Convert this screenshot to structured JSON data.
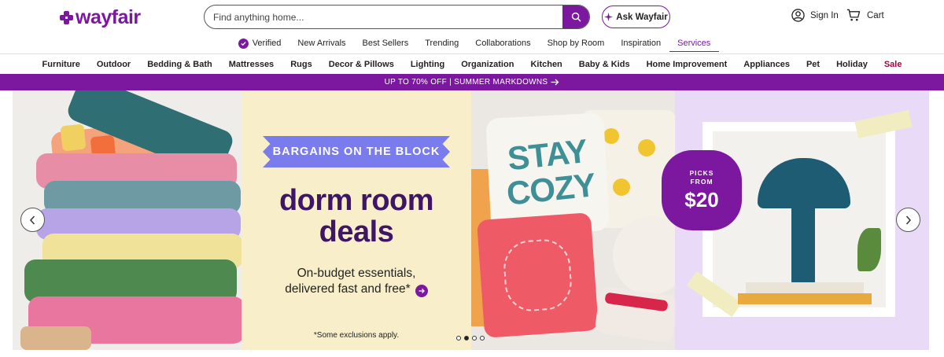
{
  "brand": {
    "name": "wayfair",
    "color": "#7b189f"
  },
  "header": {
    "search_placeholder": "Find anything home...",
    "ask_label": "Ask Wayfair",
    "sign_in_label": "Sign In",
    "cart_label": "Cart"
  },
  "subnav": [
    {
      "label": "Verified",
      "icon": "verified-badge-icon"
    },
    {
      "label": "New Arrivals"
    },
    {
      "label": "Best Sellers"
    },
    {
      "label": "Trending"
    },
    {
      "label": "Collaborations"
    },
    {
      "label": "Shop by Room"
    },
    {
      "label": "Inspiration"
    },
    {
      "label": "Services",
      "active": true
    }
  ],
  "categories": [
    "Furniture",
    "Outdoor",
    "Bedding & Bath",
    "Mattresses",
    "Rugs",
    "Decor & Pillows",
    "Lighting",
    "Organization",
    "Kitchen",
    "Baby & Kids",
    "Home Improvement",
    "Appliances",
    "Pet",
    "Holiday",
    "Sale"
  ],
  "promo_bar": {
    "text": "UP TO 70% OFF | SUMMER MARKDOWNS",
    "icon": "arrow-right-icon"
  },
  "hero": {
    "tag": "BARGAINS ON THE BLOCK",
    "headline_line1": "dorm room",
    "headline_line2": "deals",
    "subline_line1": "On-budget essentials,",
    "subline_line2": "delivered fast and free*",
    "fine_print": "*Some exclusions apply.",
    "picks_line1": "PICKS",
    "picks_line2": "FROM",
    "picks_price": "$20",
    "pillow_text_1": "STAY",
    "pillow_text_2": "COZY",
    "carousel": {
      "slides": 4,
      "active_index": 1
    }
  }
}
